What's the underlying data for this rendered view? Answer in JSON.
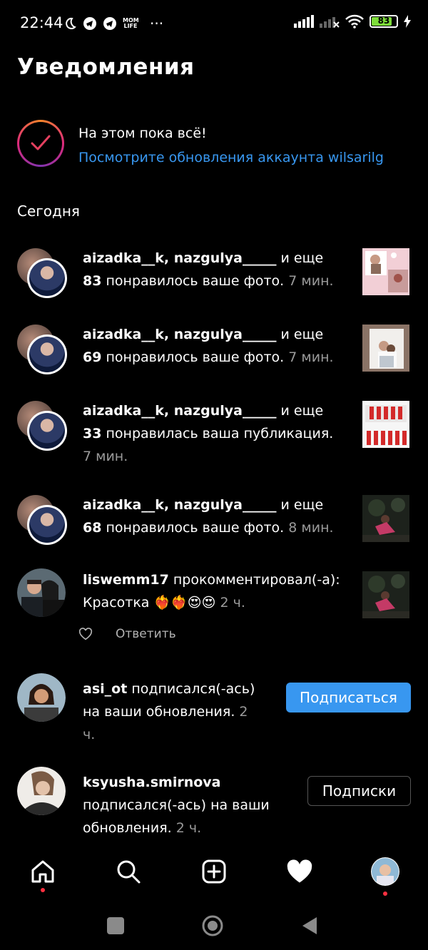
{
  "status": {
    "time": "22:44",
    "extra": "···",
    "mom_life": "MOM LIFE",
    "battery": "83",
    "battery_level": 0.83
  },
  "title": "Уведомления",
  "all_set": {
    "title": "На этом пока всё!",
    "link": "Посмотрите обновления аккаунта wilsarilg"
  },
  "section_today": "Сегодня",
  "notifications": [
    {
      "users": "aizadka__k, nazgulya_____",
      "and_more": " и еще",
      "count": "83",
      "action": " понравилось ваше фото.",
      "time": " 7 мин."
    },
    {
      "users": "aizadka__k, nazgulya_____",
      "and_more": " и еще",
      "count": "69",
      "action": " понравилось ваше фото.",
      "time": " 7 мин."
    },
    {
      "users": "aizadka__k, nazgulya_____",
      "and_more": " и еще",
      "count": "33",
      "action": " понравилась ваша публикация.",
      "time": "7 мин."
    },
    {
      "users": "aizadka__k, nazgulya_____",
      "and_more": " и еще",
      "count": "68",
      "action": " понравилось ваше фото.",
      "time": " 8 мин."
    }
  ],
  "comment": {
    "user": "liswemm17",
    "action": " прокомментировал(-а):",
    "text": "Красотка ❤️‍🔥❤️‍🔥😍😍",
    "time": " 2 ч.",
    "reply": "Ответить"
  },
  "follow1": {
    "user": "asi_ot",
    "action_line1": " подписался(-ась)",
    "action_line2": "на ваши обновления.",
    "time_a": " 2",
    "time_b": "ч.",
    "button": "Подписаться"
  },
  "follow2": {
    "user": "ksyusha.smirnova",
    "action_line1": "подписался(-ась) на ваши",
    "action_line2": "обновления.",
    "time": " 2 ч.",
    "button": "Подписки"
  },
  "colors": {
    "accent": "#3897f0",
    "badge": "#ff3040"
  },
  "icons": [
    "home-icon",
    "search-icon",
    "new-post-icon",
    "activity-heart-icon",
    "profile-avatar"
  ]
}
